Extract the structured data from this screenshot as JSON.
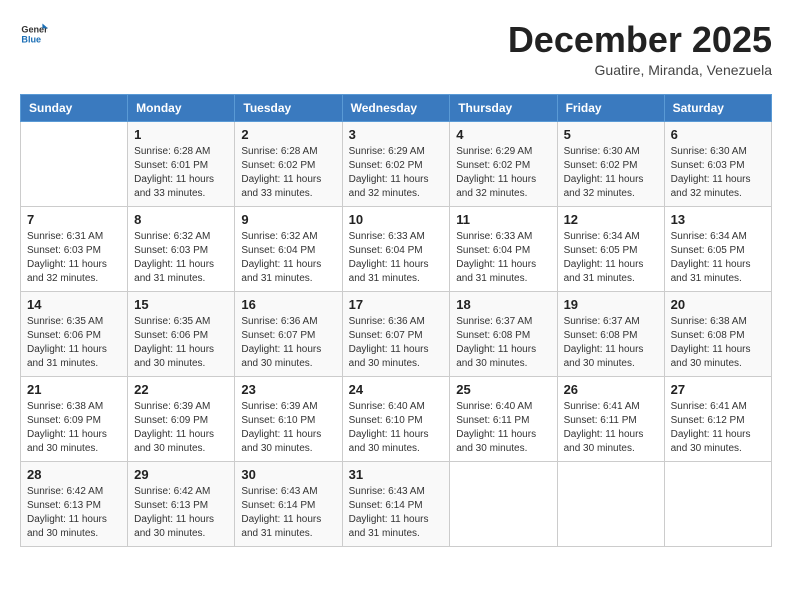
{
  "logo": {
    "text_general": "General",
    "text_blue": "Blue"
  },
  "title": "December 2025",
  "subtitle": "Guatire, Miranda, Venezuela",
  "days_of_week": [
    "Sunday",
    "Monday",
    "Tuesday",
    "Wednesday",
    "Thursday",
    "Friday",
    "Saturday"
  ],
  "weeks": [
    [
      {
        "day": "",
        "sunrise": "",
        "sunset": "",
        "daylight": ""
      },
      {
        "day": "1",
        "sunrise": "6:28 AM",
        "sunset": "6:01 PM",
        "daylight": "11 hours and 33 minutes."
      },
      {
        "day": "2",
        "sunrise": "6:28 AM",
        "sunset": "6:02 PM",
        "daylight": "11 hours and 33 minutes."
      },
      {
        "day": "3",
        "sunrise": "6:29 AM",
        "sunset": "6:02 PM",
        "daylight": "11 hours and 32 minutes."
      },
      {
        "day": "4",
        "sunrise": "6:29 AM",
        "sunset": "6:02 PM",
        "daylight": "11 hours and 32 minutes."
      },
      {
        "day": "5",
        "sunrise": "6:30 AM",
        "sunset": "6:02 PM",
        "daylight": "11 hours and 32 minutes."
      },
      {
        "day": "6",
        "sunrise": "6:30 AM",
        "sunset": "6:03 PM",
        "daylight": "11 hours and 32 minutes."
      }
    ],
    [
      {
        "day": "7",
        "sunrise": "6:31 AM",
        "sunset": "6:03 PM",
        "daylight": "11 hours and 32 minutes."
      },
      {
        "day": "8",
        "sunrise": "6:32 AM",
        "sunset": "6:03 PM",
        "daylight": "11 hours and 31 minutes."
      },
      {
        "day": "9",
        "sunrise": "6:32 AM",
        "sunset": "6:04 PM",
        "daylight": "11 hours and 31 minutes."
      },
      {
        "day": "10",
        "sunrise": "6:33 AM",
        "sunset": "6:04 PM",
        "daylight": "11 hours and 31 minutes."
      },
      {
        "day": "11",
        "sunrise": "6:33 AM",
        "sunset": "6:04 PM",
        "daylight": "11 hours and 31 minutes."
      },
      {
        "day": "12",
        "sunrise": "6:34 AM",
        "sunset": "6:05 PM",
        "daylight": "11 hours and 31 minutes."
      },
      {
        "day": "13",
        "sunrise": "6:34 AM",
        "sunset": "6:05 PM",
        "daylight": "11 hours and 31 minutes."
      }
    ],
    [
      {
        "day": "14",
        "sunrise": "6:35 AM",
        "sunset": "6:06 PM",
        "daylight": "11 hours and 31 minutes."
      },
      {
        "day": "15",
        "sunrise": "6:35 AM",
        "sunset": "6:06 PM",
        "daylight": "11 hours and 30 minutes."
      },
      {
        "day": "16",
        "sunrise": "6:36 AM",
        "sunset": "6:07 PM",
        "daylight": "11 hours and 30 minutes."
      },
      {
        "day": "17",
        "sunrise": "6:36 AM",
        "sunset": "6:07 PM",
        "daylight": "11 hours and 30 minutes."
      },
      {
        "day": "18",
        "sunrise": "6:37 AM",
        "sunset": "6:08 PM",
        "daylight": "11 hours and 30 minutes."
      },
      {
        "day": "19",
        "sunrise": "6:37 AM",
        "sunset": "6:08 PM",
        "daylight": "11 hours and 30 minutes."
      },
      {
        "day": "20",
        "sunrise": "6:38 AM",
        "sunset": "6:08 PM",
        "daylight": "11 hours and 30 minutes."
      }
    ],
    [
      {
        "day": "21",
        "sunrise": "6:38 AM",
        "sunset": "6:09 PM",
        "daylight": "11 hours and 30 minutes."
      },
      {
        "day": "22",
        "sunrise": "6:39 AM",
        "sunset": "6:09 PM",
        "daylight": "11 hours and 30 minutes."
      },
      {
        "day": "23",
        "sunrise": "6:39 AM",
        "sunset": "6:10 PM",
        "daylight": "11 hours and 30 minutes."
      },
      {
        "day": "24",
        "sunrise": "6:40 AM",
        "sunset": "6:10 PM",
        "daylight": "11 hours and 30 minutes."
      },
      {
        "day": "25",
        "sunrise": "6:40 AM",
        "sunset": "6:11 PM",
        "daylight": "11 hours and 30 minutes."
      },
      {
        "day": "26",
        "sunrise": "6:41 AM",
        "sunset": "6:11 PM",
        "daylight": "11 hours and 30 minutes."
      },
      {
        "day": "27",
        "sunrise": "6:41 AM",
        "sunset": "6:12 PM",
        "daylight": "11 hours and 30 minutes."
      }
    ],
    [
      {
        "day": "28",
        "sunrise": "6:42 AM",
        "sunset": "6:13 PM",
        "daylight": "11 hours and 30 minutes."
      },
      {
        "day": "29",
        "sunrise": "6:42 AM",
        "sunset": "6:13 PM",
        "daylight": "11 hours and 30 minutes."
      },
      {
        "day": "30",
        "sunrise": "6:43 AM",
        "sunset": "6:14 PM",
        "daylight": "11 hours and 31 minutes."
      },
      {
        "day": "31",
        "sunrise": "6:43 AM",
        "sunset": "6:14 PM",
        "daylight": "11 hours and 31 minutes."
      },
      {
        "day": "",
        "sunrise": "",
        "sunset": "",
        "daylight": ""
      },
      {
        "day": "",
        "sunrise": "",
        "sunset": "",
        "daylight": ""
      },
      {
        "day": "",
        "sunrise": "",
        "sunset": "",
        "daylight": ""
      }
    ]
  ],
  "labels": {
    "sunrise": "Sunrise:",
    "sunset": "Sunset:",
    "daylight": "Daylight:"
  }
}
